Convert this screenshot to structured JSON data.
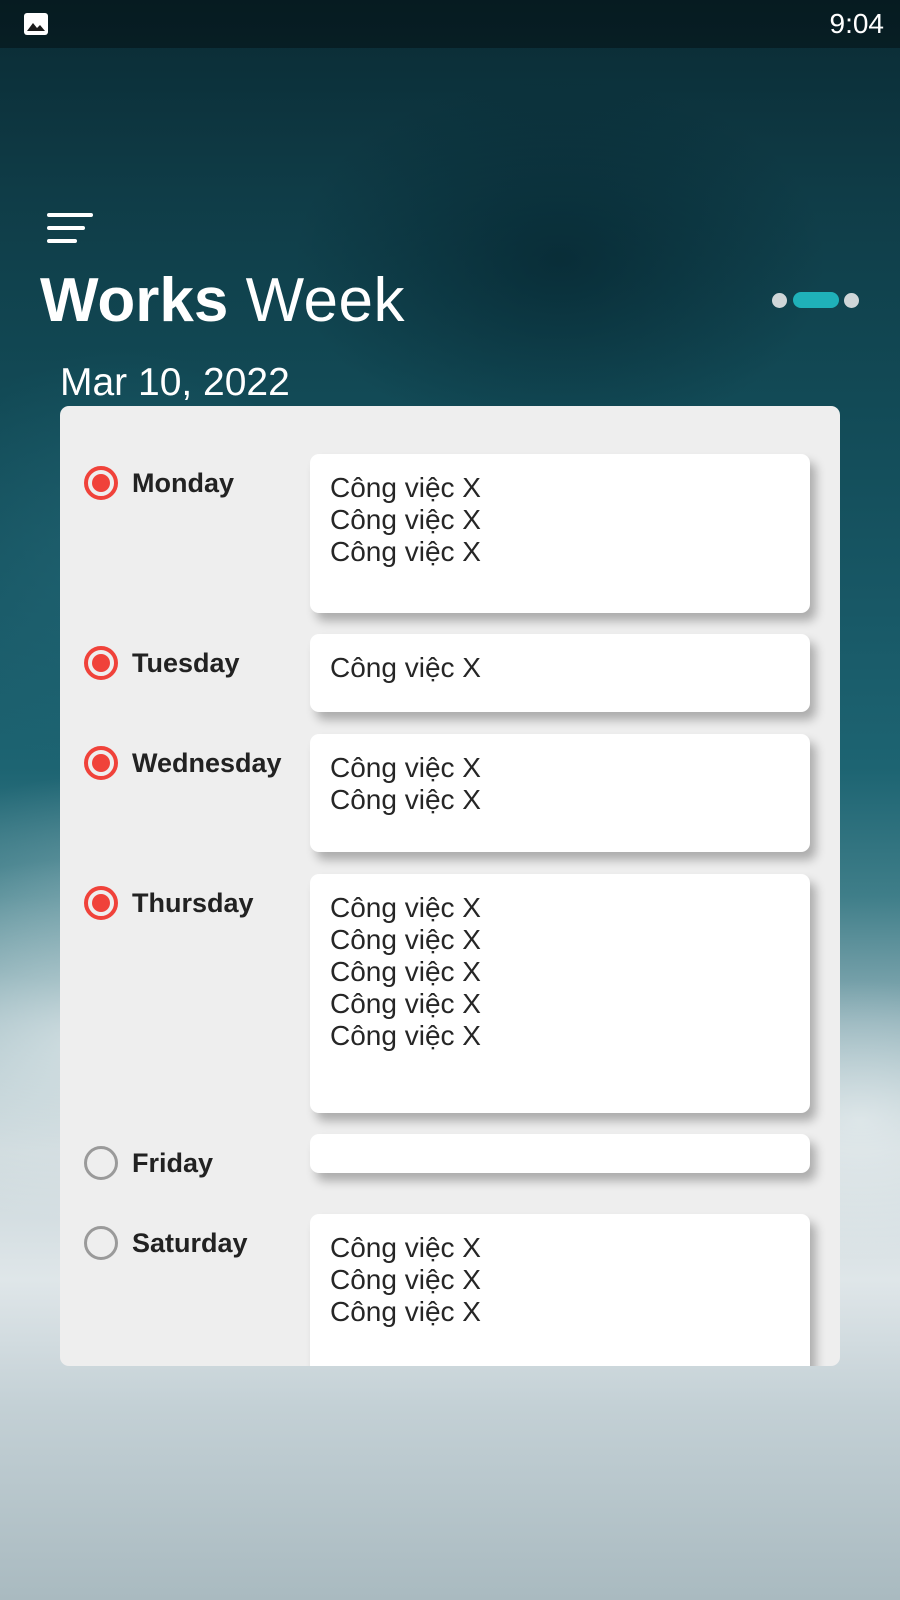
{
  "status_bar": {
    "time": "9:04",
    "notification_icon": "image-icon"
  },
  "header": {
    "menu_icon": "menu-icon",
    "title_bold": "Works",
    "title_light": "Week",
    "page_indicator": {
      "count": 3,
      "active_index": 1
    }
  },
  "date": "Mar 10, 2022",
  "colors": {
    "radio_checked": "#f0423a",
    "radio_unchecked": "#9a9a9a",
    "indicator_active": "#1fb1b9",
    "indicator_inactive": "#cfd6d8",
    "card_background": "#eeeeee"
  },
  "days": [
    {
      "name": "Monday",
      "checked": true,
      "tasks": [
        "Công việc X",
        "Công việc X",
        "Công việc X"
      ]
    },
    {
      "name": "Tuesday",
      "checked": true,
      "tasks": [
        "Công việc X"
      ]
    },
    {
      "name": "Wednesday",
      "checked": true,
      "tasks": [
        "Công việc X",
        "Công việc X"
      ]
    },
    {
      "name": "Thursday",
      "checked": true,
      "tasks": [
        "Công việc X",
        "Công việc X",
        "Công việc X",
        "Công việc X",
        "Công việc X"
      ]
    },
    {
      "name": "Friday",
      "checked": false,
      "tasks": []
    },
    {
      "name": "Saturday",
      "checked": false,
      "tasks": [
        "Công việc X",
        "Công việc X",
        "Công việc X"
      ]
    }
  ]
}
